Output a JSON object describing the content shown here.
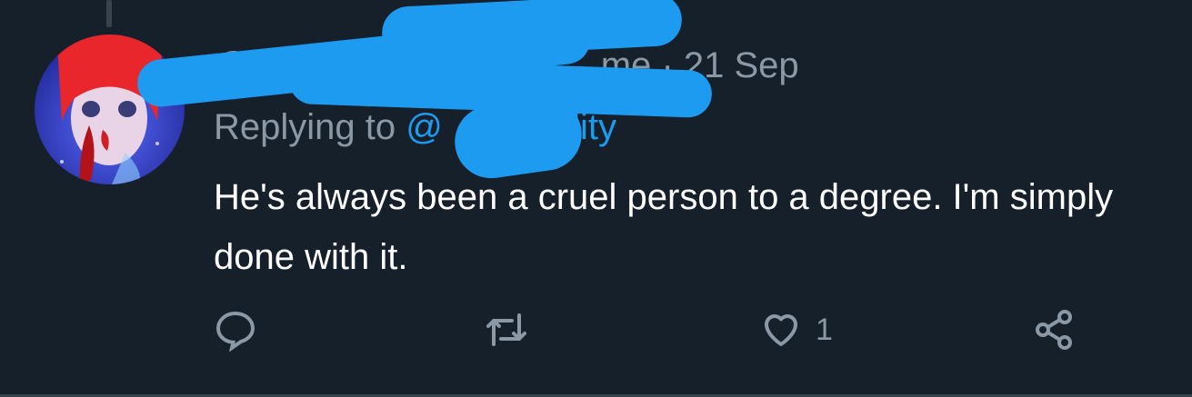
{
  "tweet": {
    "handle_fragment": "@",
    "handle_suffix": "me",
    "separator": "·",
    "date": "21 Sep",
    "reply_prefix": "Replying to",
    "reply_mention": "@",
    "reply_mention_suffix": "ality",
    "text": "He's always been a cruel person to a degree. I'm simply done with it."
  },
  "actions": {
    "reply_count": "",
    "retweet_count": "",
    "like_count": "1"
  },
  "colors": {
    "background": "#15202b",
    "secondary_text": "#8b98a5",
    "accent": "#1d9bf0",
    "divider": "#38444d"
  },
  "icons": [
    "reply-icon",
    "retweet-icon",
    "like-icon",
    "share-icon"
  ]
}
